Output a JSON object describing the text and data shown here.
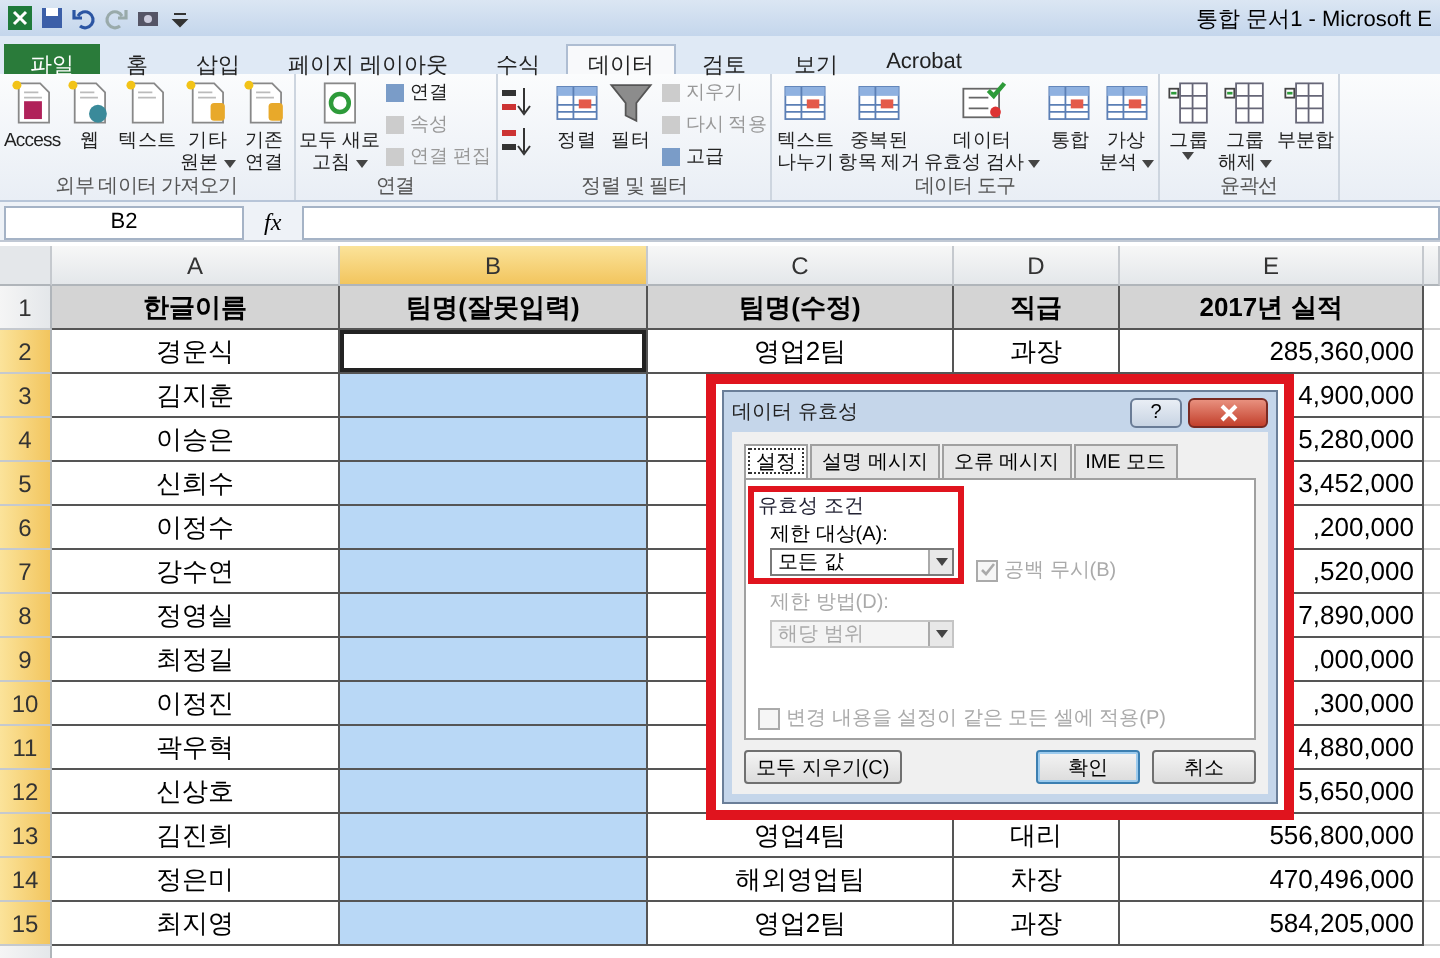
{
  "title_bar": {
    "title": "통합 문서1  -  Microsoft E"
  },
  "ribbon_tabs": [
    {
      "label": "파일",
      "kind": "file",
      "selected": false
    },
    {
      "label": "홈",
      "kind": "tab",
      "selected": false
    },
    {
      "label": "삽입",
      "kind": "tab",
      "selected": false
    },
    {
      "label": "페이지 레이아웃",
      "kind": "tab",
      "selected": false
    },
    {
      "label": "수식",
      "kind": "tab",
      "selected": false
    },
    {
      "label": "데이터",
      "kind": "tab",
      "selected": true
    },
    {
      "label": "검토",
      "kind": "tab",
      "selected": false
    },
    {
      "label": "보기",
      "kind": "tab",
      "selected": false
    },
    {
      "label": "Acrobat",
      "kind": "tab",
      "selected": false
    }
  ],
  "ribbon_groups": [
    {
      "label": "외부 데이터 가져오기",
      "items": [
        {
          "kind": "large",
          "lines": [
            "Access"
          ],
          "menu": false
        },
        {
          "kind": "large",
          "lines": [
            "웹"
          ],
          "menu": false
        },
        {
          "kind": "large",
          "lines": [
            "텍스트"
          ],
          "menu": false
        },
        {
          "kind": "large",
          "lines": [
            "기타",
            "원본"
          ],
          "menu": true
        },
        {
          "kind": "large",
          "lines": [
            "기존",
            "연결"
          ],
          "menu": false
        }
      ]
    },
    {
      "label": "연결",
      "items": [
        {
          "kind": "large",
          "lines": [
            "모두 새로",
            "고침"
          ],
          "menu": true
        },
        {
          "kind": "stack",
          "items": [
            {
              "label": "연결",
              "disabled": false
            },
            {
              "label": "속성",
              "disabled": true
            },
            {
              "label": "연결 편집",
              "disabled": true
            }
          ]
        }
      ]
    },
    {
      "label": "정렬 및 필터",
      "items": [
        {
          "kind": "sort"
        },
        {
          "kind": "large",
          "lines": [
            "정렬"
          ],
          "menu": false
        },
        {
          "kind": "large",
          "lines": [
            "필터"
          ],
          "menu": false
        },
        {
          "kind": "stack",
          "items": [
            {
              "label": "지우기",
              "disabled": true
            },
            {
              "label": "다시 적용",
              "disabled": true
            },
            {
              "label": "고급",
              "disabled": false
            }
          ]
        }
      ]
    },
    {
      "label": "데이터 도구",
      "items": [
        {
          "kind": "large",
          "lines": [
            "텍스트",
            "나누기"
          ],
          "menu": false
        },
        {
          "kind": "large",
          "lines": [
            "중복된",
            "항목 제거"
          ],
          "menu": false
        },
        {
          "kind": "large",
          "lines": [
            "데이터",
            "유효성 검사"
          ],
          "menu": true
        },
        {
          "kind": "large",
          "lines": [
            "통합"
          ],
          "menu": false
        },
        {
          "kind": "large",
          "lines": [
            "가상",
            "분석"
          ],
          "menu": true
        }
      ]
    },
    {
      "label": "윤곽선",
      "items": [
        {
          "kind": "large",
          "lines": [
            "그룹"
          ],
          "menu": true
        },
        {
          "kind": "large",
          "lines": [
            "그룹",
            "해제"
          ],
          "menu": true
        },
        {
          "kind": "large",
          "lines": [
            "부분합"
          ],
          "menu": false
        }
      ]
    }
  ],
  "formula_bar": {
    "name_box": "B2",
    "function_button": "fx"
  },
  "sheet": {
    "columns": [
      {
        "label": "A",
        "selected": false
      },
      {
        "label": "B",
        "selected": true
      },
      {
        "label": "C",
        "selected": false
      },
      {
        "label": "D",
        "selected": false
      },
      {
        "label": "E",
        "selected": false
      }
    ],
    "rows": [
      {
        "number": "1",
        "selected": false,
        "kind": "header",
        "cells": [
          {
            "text": "한글이름",
            "selected": false
          },
          {
            "text": "팀명(잘못입력)",
            "selected": false
          },
          {
            "text": "팀명(수정)",
            "selected": false
          },
          {
            "text": "직급",
            "selected": false
          },
          {
            "text": "2017년 실적",
            "selected": false
          }
        ]
      },
      {
        "number": "2",
        "selected": true,
        "kind": "data",
        "cells": [
          {
            "text": "경운식",
            "selected": false
          },
          {
            "active": true
          },
          {
            "text": "영업2팀",
            "selected": false
          },
          {
            "text": "과장",
            "selected": false
          },
          {
            "text": "285,360,000",
            "selected": false
          }
        ]
      },
      {
        "number": "3",
        "selected": true,
        "kind": "data",
        "cells": [
          {
            "text": "김지훈",
            "selected": false
          },
          {
            "selected": true
          },
          null,
          null,
          {
            "text": "4,900,000",
            "selected": false
          }
        ]
      },
      {
        "number": "4",
        "selected": true,
        "kind": "data",
        "cells": [
          {
            "text": "이승은",
            "selected": false
          },
          {
            "selected": true
          },
          null,
          null,
          {
            "text": "5,280,000",
            "selected": false
          }
        ]
      },
      {
        "number": "5",
        "selected": true,
        "kind": "data",
        "cells": [
          {
            "text": "신희수",
            "selected": false
          },
          {
            "selected": true
          },
          null,
          null,
          {
            "text": "3,452,000",
            "selected": false
          }
        ]
      },
      {
        "number": "6",
        "selected": true,
        "kind": "data",
        "cells": [
          {
            "text": "이정수",
            "selected": false
          },
          {
            "selected": true
          },
          null,
          null,
          {
            "text": ",200,000",
            "selected": false
          }
        ]
      },
      {
        "number": "7",
        "selected": true,
        "kind": "data",
        "cells": [
          {
            "text": "강수연",
            "selected": false
          },
          {
            "selected": true
          },
          null,
          null,
          {
            "text": ",520,000",
            "selected": false
          }
        ]
      },
      {
        "number": "8",
        "selected": true,
        "kind": "data",
        "cells": [
          {
            "text": "정영실",
            "selected": false
          },
          {
            "selected": true
          },
          null,
          null,
          {
            "text": "7,890,000",
            "selected": false
          }
        ]
      },
      {
        "number": "9",
        "selected": true,
        "kind": "data",
        "cells": [
          {
            "text": "최정길",
            "selected": false
          },
          {
            "selected": true
          },
          null,
          null,
          {
            "text": ",000,000",
            "selected": false
          }
        ]
      },
      {
        "number": "10",
        "selected": true,
        "kind": "data",
        "cells": [
          {
            "text": "이정진",
            "selected": false
          },
          {
            "selected": true
          },
          null,
          null,
          {
            "text": ",300,000",
            "selected": false
          }
        ]
      },
      {
        "number": "11",
        "selected": true,
        "kind": "data",
        "cells": [
          {
            "text": "곽우혁",
            "selected": false
          },
          {
            "selected": true
          },
          null,
          null,
          {
            "text": "4,880,000",
            "selected": false
          }
        ]
      },
      {
        "number": "12",
        "selected": true,
        "kind": "data",
        "cells": [
          {
            "text": "신상호",
            "selected": false
          },
          {
            "selected": true
          },
          null,
          null,
          {
            "text": "5,650,000",
            "selected": false
          }
        ]
      },
      {
        "number": "13",
        "selected": true,
        "kind": "data",
        "cells": [
          {
            "text": "김진희",
            "selected": false
          },
          {
            "selected": true
          },
          {
            "text": "영업4팀",
            "selected": false
          },
          {
            "text": "대리",
            "selected": false
          },
          {
            "text": "556,800,000",
            "selected": false
          }
        ]
      },
      {
        "number": "14",
        "selected": true,
        "kind": "data",
        "cells": [
          {
            "text": "정은미",
            "selected": false
          },
          {
            "selected": true
          },
          {
            "text": "해외영업팀",
            "selected": false
          },
          {
            "text": "차장",
            "selected": false
          },
          {
            "text": "470,496,000",
            "selected": false
          }
        ]
      },
      {
        "number": "15",
        "selected": true,
        "kind": "data",
        "cells": [
          {
            "text": "최지영",
            "selected": false
          },
          {
            "selected": true
          },
          {
            "text": "영업2팀",
            "selected": false
          },
          {
            "text": "과장",
            "selected": false
          },
          {
            "text": "584,205,000",
            "selected": false
          }
        ]
      }
    ]
  },
  "dialog": {
    "title": "데이터 유효성",
    "help": "?",
    "tabs": [
      {
        "label": "설정",
        "selected": true
      },
      {
        "label": "설명 메시지",
        "selected": false
      },
      {
        "label": "오류 메시지",
        "selected": false
      },
      {
        "label": "IME 모드",
        "selected": false
      }
    ],
    "group_label": "유효성 조건",
    "allow_label": "제한 대상(A):",
    "allow_value": "모든 값",
    "ignore_blank": {
      "label": "공백 무시(B)",
      "checked": true,
      "disabled": true
    },
    "data_label": {
      "text": "제한 방법(D):",
      "disabled": true
    },
    "data_value": {
      "text": "해당 범위",
      "disabled": true
    },
    "apply_all": {
      "label": "변경 내용을 설정이 같은 모든 셀에 적용(P)",
      "checked": false,
      "disabled": true
    },
    "buttons": [
      {
        "label": "모두 지우기(C)",
        "kind": "clear"
      },
      {
        "label": "확인",
        "kind": "default"
      },
      {
        "label": "취소",
        "kind": "cancel"
      }
    ]
  }
}
